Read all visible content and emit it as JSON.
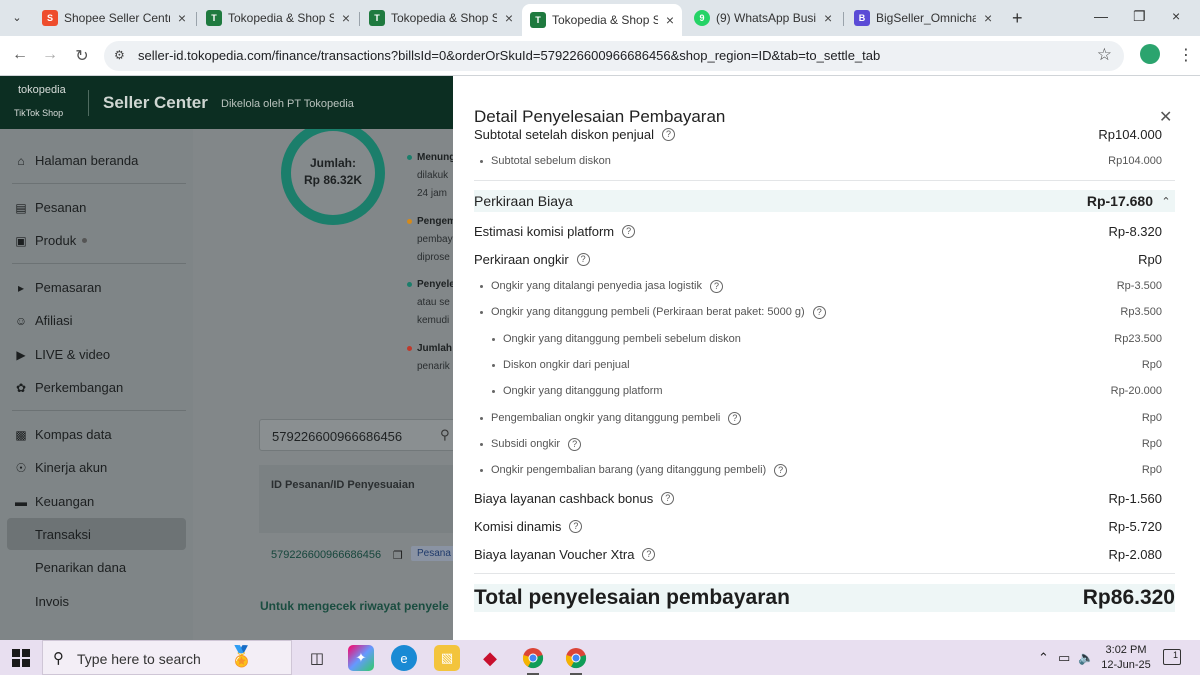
{
  "browser": {
    "tabs": [
      {
        "title": "Shopee Seller Centre",
        "color": "#ee4d2d",
        "glyph": "S"
      },
      {
        "title": "Tokopedia & Shop Se",
        "color": "#1f7a3f",
        "glyph": "T"
      },
      {
        "title": "Tokopedia & Shop Se",
        "color": "#1f7a3f",
        "glyph": "T"
      },
      {
        "title": "Tokopedia & Shop Se",
        "color": "#1f7a3f",
        "glyph": "T"
      },
      {
        "title": "(9) WhatsApp Busine",
        "color": "#25d366",
        "glyph": "9"
      },
      {
        "title": "BigSeller_Omnichann",
        "color": "#5b4bd6",
        "glyph": "B"
      }
    ],
    "url": "seller-id.tokopedia.com/finance/transactions?billsId=0&orderOrSkuId=579226600966686456&shop_region=ID&tab=to_settle_tab"
  },
  "header": {
    "brand_top": "tokopedia",
    "brand_bottom": "TikTok Shop",
    "title": "Seller Center",
    "subtitle": "Dikelola oleh PT Tokopedia"
  },
  "sidebar": {
    "items": [
      {
        "label": "Halaman beranda",
        "icon": "home-icon"
      },
      {
        "label": "Pesanan",
        "icon": "clipboard-icon"
      },
      {
        "label": "Produk",
        "icon": "box-icon"
      },
      {
        "label": "Pemasaran",
        "icon": "megaphone-icon"
      },
      {
        "label": "Afiliasi",
        "icon": "users-icon"
      },
      {
        "label": "LIVE & video",
        "icon": "video-icon"
      },
      {
        "label": "Perkembangan",
        "icon": "growth-icon"
      },
      {
        "label": "Kompas data",
        "icon": "chart-icon"
      },
      {
        "label": "Kinerja akun",
        "icon": "trophy-icon"
      },
      {
        "label": "Keuangan",
        "icon": "wallet-icon"
      },
      {
        "label": "Transaksi"
      },
      {
        "label": "Penarikan dana"
      },
      {
        "label": "Invois"
      }
    ]
  },
  "content": {
    "donut_label": "Jumlah:",
    "donut_value": "Rp 86.32K",
    "legend": [
      {
        "lines": [
          "Menung",
          "dilakuk",
          "24 jam"
        ],
        "color": "#1b7e6b"
      },
      {
        "lines": [
          "Pengem",
          "pembay",
          "diprose"
        ],
        "color": "#d58a1a"
      },
      {
        "lines": [
          "Penyele",
          "atau se",
          "kemudi"
        ],
        "color": "#1b7e6b"
      },
      {
        "lines": [
          "Jumlah",
          "penarik"
        ],
        "color": "#c0392b"
      }
    ],
    "search_value": "579226600966686456",
    "table_header": "ID Pesanan/ID Penyesuaian",
    "order_id": "579226600966686456",
    "order_tag": "Pesana",
    "history_link": "Untuk mengecek riwayat penyele"
  },
  "drawer": {
    "title": "Detail Penyelesaian Pembayaran",
    "subtotal_label": "Subtotal setelah diskon penjual",
    "subtotal_amount": "Rp104.000",
    "subtotal_before_label": "Subtotal sebelum diskon",
    "subtotal_before_amount": "Rp104.000",
    "section_label": "Perkiraan Biaya",
    "section_amount": "Rp-17.680",
    "commission_label": "Estimasi komisi platform",
    "commission_amount": "Rp-8.320",
    "shipping_label": "Perkiraan ongkir",
    "shipping_amount": "Rp0",
    "ship_logistics_label": "Ongkir yang ditalangi penyedia jasa logistik",
    "ship_logistics_amount": "Rp-3.500",
    "ship_buyer_label": "Ongkir yang ditanggung pembeli (Perkiraan berat paket: 5000 g)",
    "ship_buyer_amount": "Rp3.500",
    "ship_buyer_before_label": "Ongkir yang ditanggung pembeli sebelum diskon",
    "ship_buyer_before_amount": "Rp23.500",
    "ship_seller_disc_label": "Diskon ongkir dari penjual",
    "ship_seller_disc_amount": "Rp0",
    "ship_platform_label": "Ongkir yang ditanggung platform",
    "ship_platform_amount": "Rp-20.000",
    "ship_return_label": "Pengembalian ongkir yang ditanggung pembeli",
    "ship_return_amount": "Rp0",
    "ship_subsidy_label": "Subsidi ongkir",
    "ship_subsidy_amount": "Rp0",
    "ship_goods_return_label": "Ongkir pengembalian barang (yang ditanggung pembeli)",
    "ship_goods_return_amount": "Rp0",
    "cashback_label": "Biaya layanan cashback bonus",
    "cashback_amount": "Rp-1.560",
    "dynamic_label": "Komisi dinamis",
    "dynamic_amount": "Rp-5.720",
    "voucher_label": "Biaya layanan Voucher Xtra",
    "voucher_amount": "Rp-2.080",
    "total_label": "Total penyelesaian pembayaran",
    "total_amount": "Rp86.320"
  },
  "taskbar": {
    "search_placeholder": "Type here to search",
    "time": "3:02 PM",
    "date": "12-Jun-25",
    "notifications": "1"
  }
}
